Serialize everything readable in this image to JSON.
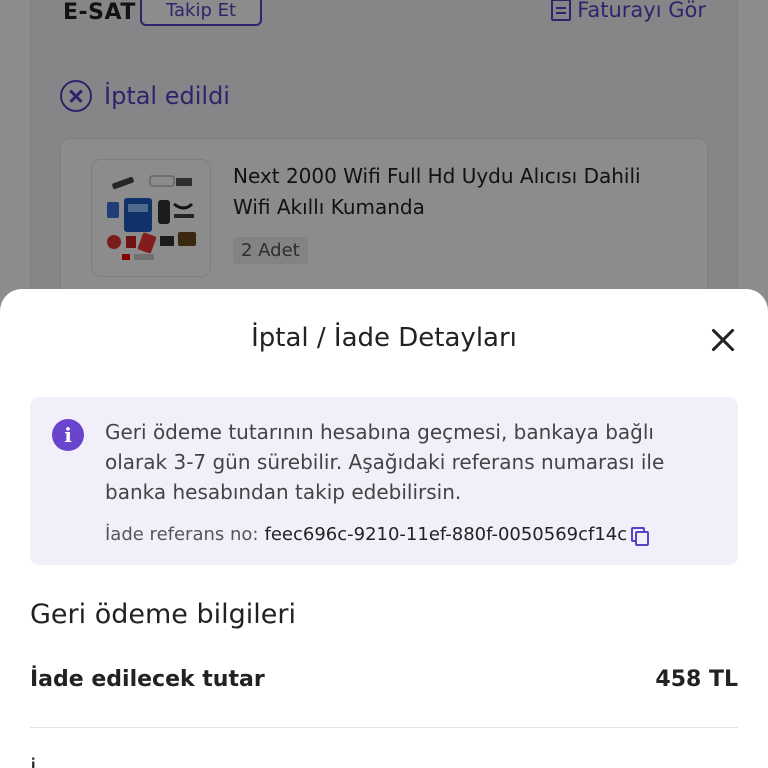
{
  "background": {
    "carrier": "E-SAT",
    "track_label": "Takip Et",
    "invoice_label": "Faturayı Gör",
    "status_label": "İptal edildi",
    "product": {
      "title": "Next 2000 Wifi Full Hd Uydu Alıcısı Dahili Wifi Akıllı Kumanda",
      "quantity": "2 Adet"
    }
  },
  "sheet": {
    "title": "İptal / İade Detayları",
    "info_text": "Geri ödeme tutarının hesabına geçmesi, bankaya bağlı olarak 3-7 gün sürebilir. Aşağıdaki referans numarası ile banka hesabından takip edebilirsin.",
    "ref_label": "İade referans no:",
    "ref_value": "feec696c-9210-11ef-880f-0050569cf14c",
    "section_title": "Geri ödeme bilgileri",
    "refund_label": "İade edilecek tutar",
    "refund_value": "458 TL",
    "next_row_label": "İ"
  },
  "colors": {
    "accent": "#5b3fc4",
    "info_bg": "#f1effa",
    "info_icon": "#6a44cc"
  }
}
